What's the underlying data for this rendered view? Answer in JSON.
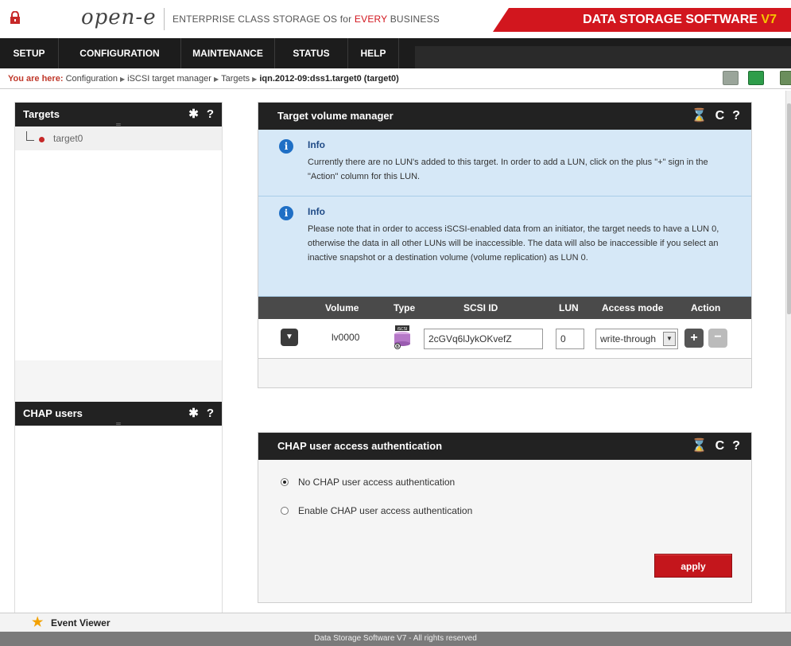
{
  "header": {
    "logo": "open-e",
    "tagline_pre": "ENTERPRISE CLASS STORAGE OS for ",
    "tagline_red": "EVERY",
    "tagline_post": " BUSINESS",
    "brand": "DATA STORAGE SOFTWARE ",
    "brand_version": "V7",
    "brand_color": "#d2161e"
  },
  "nav": [
    "SETUP",
    "CONFIGURATION",
    "MAINTENANCE",
    "STATUS",
    "HELP"
  ],
  "breadcrumb": {
    "label": "You are here:",
    "items": [
      "Configuration",
      "iSCSI target manager",
      "Targets"
    ],
    "current": "iqn.2012-09:dss1.target0 (target0)"
  },
  "sidebar": {
    "targets_title": "Targets",
    "targets_items": [
      "target0"
    ],
    "chap_title": "CHAP users"
  },
  "target_volume_manager": {
    "title": "Target volume manager",
    "info1_title": "Info",
    "info1_text": "Currently there are no LUN's added to this target. In order to add a LUN, click on the plus \"+\" sign in the \"Action\" column for this LUN.",
    "info2_title": "Info",
    "info2_text": "Please note that in order to access iSCSI-enabled data from an initiator, the target needs to have a LUN 0, otherwise the data in all other LUNs will be inaccessible. The data will also be inaccessible if you select an inactive snapshot or a destination volume (volume replication) as LUN 0.",
    "columns": [
      "Volume",
      "Type",
      "SCSI ID",
      "LUN",
      "Access mode",
      "Action"
    ],
    "row": {
      "volume": "lv0000",
      "type_icon": "iSCSI",
      "scsi_id": "2cGVq6lJykOKvefZ",
      "lun": "0",
      "access_mode": "write-through"
    }
  },
  "chap": {
    "title": "CHAP user access authentication",
    "option_none": "No CHAP user access authentication",
    "option_enable": "Enable CHAP user access authentication",
    "selected": "none",
    "apply": "apply"
  },
  "footer": {
    "event_viewer": "Event Viewer",
    "copyright": "Data Storage Software V7 - All rights reserved"
  }
}
